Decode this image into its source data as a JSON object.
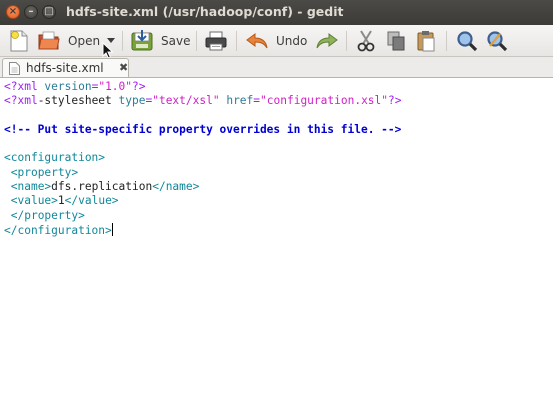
{
  "window": {
    "title": "hdfs-site.xml (/usr/hadoop/conf) - gedit"
  },
  "titlebar_buttons": {
    "close_glyph": "×",
    "minimize_glyph": "–",
    "maximize_glyph": "□"
  },
  "toolbar": {
    "new_icon": "new-document-icon",
    "open_label": "Open",
    "save_label": "Save",
    "undo_label": "Undo",
    "icons": [
      "new-document-icon",
      "open-folder-icon",
      "dropdown-arrow-icon",
      "save-icon",
      "print-icon",
      "undo-icon",
      "redo-icon",
      "cut-icon",
      "copy-icon",
      "paste-icon",
      "find-icon",
      "find-replace-icon"
    ]
  },
  "tab": {
    "label": "hdfs-site.xml",
    "close_glyph": "✖"
  },
  "editor": {
    "lines": [
      {
        "parts": [
          [
            "pi",
            "<?xml "
          ],
          [
            "attr",
            "version"
          ],
          [
            "pi",
            "="
          ],
          [
            "str",
            "\"1.0\""
          ],
          [
            "pi",
            "?>"
          ]
        ]
      },
      {
        "parts": [
          [
            "pi",
            "<?xml"
          ],
          [
            "txt",
            "-stylesheet "
          ],
          [
            "attr",
            "type"
          ],
          [
            "pi",
            "="
          ],
          [
            "str",
            "\"text/xsl\""
          ],
          [
            "txt",
            " "
          ],
          [
            "attr",
            "href"
          ],
          [
            "pi",
            "="
          ],
          [
            "str",
            "\"configuration.xsl\""
          ],
          [
            "pi",
            "?>"
          ]
        ]
      },
      {
        "parts": []
      },
      {
        "parts": [
          [
            "cmt",
            "<!-- Put site-specific property overrides in this file. -->"
          ]
        ]
      },
      {
        "parts": []
      },
      {
        "parts": [
          [
            "tag",
            "<configuration>"
          ]
        ]
      },
      {
        "parts": [
          [
            "txt",
            " "
          ],
          [
            "tag",
            "<property>"
          ]
        ]
      },
      {
        "parts": [
          [
            "txt",
            " "
          ],
          [
            "tag",
            "<name>"
          ],
          [
            "txt",
            "dfs.replication"
          ],
          [
            "tag",
            "</name>"
          ]
        ]
      },
      {
        "parts": [
          [
            "txt",
            " "
          ],
          [
            "tag",
            "<value>"
          ],
          [
            "txt",
            "1"
          ],
          [
            "tag",
            "</value>"
          ]
        ]
      },
      {
        "parts": [
          [
            "txt",
            " "
          ],
          [
            "tag",
            "</property>"
          ]
        ]
      },
      {
        "parts": [
          [
            "tag",
            "</configuration>"
          ]
        ],
        "caret": true
      }
    ]
  }
}
